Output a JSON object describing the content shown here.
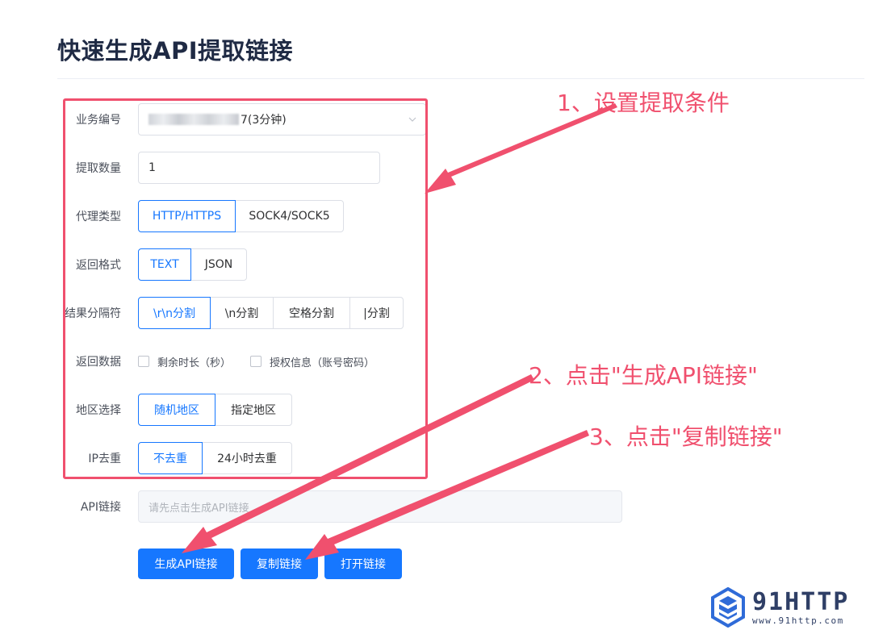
{
  "page": {
    "title": "快速生成API提取链接"
  },
  "form": {
    "business": {
      "label": "业务编号",
      "value_suffix": "7(3分钟)"
    },
    "quantity": {
      "label": "提取数量",
      "value": "1"
    },
    "proxy_type": {
      "label": "代理类型",
      "options": [
        "HTTP/HTTPS",
        "SOCK4/SOCK5"
      ],
      "selected": "HTTP/HTTPS"
    },
    "return_format": {
      "label": "返回格式",
      "options": [
        "TEXT",
        "JSON"
      ],
      "selected": "TEXT"
    },
    "separator": {
      "label": "结果分隔符",
      "options": [
        "\\r\\n分割",
        "\\n分割",
        "空格分割",
        "|分割"
      ],
      "selected": "\\r\\n分割"
    },
    "return_data": {
      "label": "返回数据",
      "options": [
        "剩余时长（秒）",
        "授权信息（账号密码）"
      ]
    },
    "region": {
      "label": "地区选择",
      "options": [
        "随机地区",
        "指定地区"
      ],
      "selected": "随机地区"
    },
    "ip_dedup": {
      "label": "IP去重",
      "options": [
        "不去重",
        "24小时去重"
      ],
      "selected": "不去重"
    },
    "api_link": {
      "label": "API链接",
      "placeholder": "请先点击生成API链接"
    }
  },
  "buttons": {
    "generate": "生成API链接",
    "copy": "复制链接",
    "open": "打开链接"
  },
  "annotations": {
    "step1": "1、设置提取条件",
    "step2": "2、点击\"生成API链接\"",
    "step3": "3、点击\"复制链接\""
  },
  "logo": {
    "name": "91HTTP",
    "url": "www.91http.com"
  },
  "colors": {
    "primary": "#1677ff",
    "annotation": "#f0506e",
    "logo": "#2f3f66"
  },
  "icons": {
    "select_arrow": "chevron-down-icon",
    "logo_mark": "hexagon-logo-icon"
  }
}
